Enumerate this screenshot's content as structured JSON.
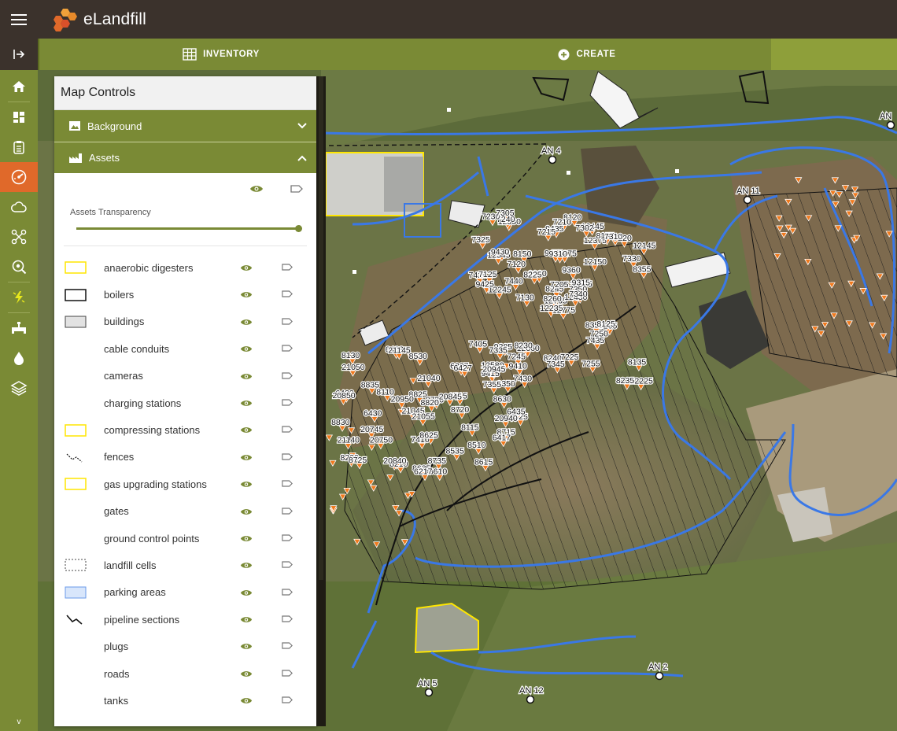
{
  "app": {
    "name": "eLandfill"
  },
  "tabs": [
    {
      "label": "INVENTORY",
      "icon": "table-icon"
    },
    {
      "label": "CREATE",
      "icon": "add-circle-icon"
    }
  ],
  "rail": {
    "items": [
      "home-icon",
      "dashboard-icon",
      "clipboard-icon",
      "gauge-icon",
      "cloud-icon",
      "drone-icon",
      "search-eye-icon",
      "lightning-icon",
      "pipe-icon",
      "drop-icon",
      "layers-icon"
    ],
    "active_index": 3,
    "bottom_label": "v"
  },
  "panel": {
    "title": "Map Controls",
    "sections": [
      {
        "label": "Background",
        "expanded": false
      },
      {
        "label": "Assets",
        "expanded": true
      }
    ],
    "transparency_label": "Assets Transparency",
    "transparency_value": 1.0,
    "layers": [
      {
        "label": "anaerobic digesters",
        "swatch": "yellow-box"
      },
      {
        "label": "boilers",
        "swatch": "black-box"
      },
      {
        "label": "buildings",
        "swatch": "grey-box"
      },
      {
        "label": "cable conduits",
        "swatch": "none"
      },
      {
        "label": "cameras",
        "swatch": "none"
      },
      {
        "label": "charging stations",
        "swatch": "none"
      },
      {
        "label": "compressing stations",
        "swatch": "yellow-box"
      },
      {
        "label": "fences",
        "swatch": "fence-line"
      },
      {
        "label": "gas upgrading stations",
        "swatch": "yellow-box"
      },
      {
        "label": "gates",
        "swatch": "none"
      },
      {
        "label": "ground control points",
        "swatch": "none"
      },
      {
        "label": "landfill cells",
        "swatch": "dashed-box"
      },
      {
        "label": "parking areas",
        "swatch": "blue-box"
      },
      {
        "label": "pipeline sections",
        "swatch": "pipe-line"
      },
      {
        "label": "plugs",
        "swatch": "none"
      },
      {
        "label": "roads",
        "swatch": "none"
      },
      {
        "label": "tanks",
        "swatch": "none"
      }
    ]
  },
  "map": {
    "anchors": [
      "AN 4",
      "AN 11",
      "AN 5",
      "AN 12",
      "AN 2",
      "AN"
    ],
    "well_labels": [
      "12775",
      "12545",
      "12765",
      "12580",
      "12675",
      "12660",
      "12445",
      "12275",
      "12375",
      "12430",
      "12330",
      "12225",
      "12245",
      "12145",
      "12235",
      "12150",
      "9350",
      "9455",
      "9360",
      "9385",
      "9260",
      "9415",
      "9410",
      "9310",
      "9315",
      "9205",
      "9430",
      "9435",
      "9425",
      "8350",
      "8355",
      "8260",
      "8240",
      "8245",
      "8150",
      "8155",
      "8230",
      "8235",
      "8135",
      "8125",
      "8120",
      "8225",
      "7440",
      "7435",
      "7430",
      "7425",
      "7350",
      "7355",
      "7345",
      "7340",
      "7335",
      "7330",
      "7325",
      "7250",
      "7255",
      "7245",
      "7240",
      "7230",
      "7225",
      "7220",
      "7210",
      "7130",
      "7125",
      "7120",
      "7310",
      "7305",
      "7302",
      "7215",
      "7205",
      "7405",
      "7410",
      "8210",
      "8115",
      "8110",
      "8220",
      "8130",
      "8835",
      "8830",
      "8825",
      "8735",
      "8730",
      "8725",
      "8720",
      "8715",
      "8635",
      "8630",
      "8625",
      "8615",
      "8610",
      "8535",
      "8530",
      "8525",
      "8515",
      "8510",
      "8820",
      "6417",
      "6422",
      "6217",
      "6227",
      "6427",
      "6430",
      "6433",
      "6435",
      "20850",
      "20745",
      "20750",
      "20840",
      "20845",
      "20945",
      "20950",
      "20940",
      "21050",
      "21040",
      "21045",
      "21145",
      "21140",
      "21055"
    ]
  },
  "colors": {
    "brand": "#7a8a35",
    "topbar": "#3b322c",
    "active": "#e0692a",
    "pipe": "#3a78e6",
    "well": "#f07a1e",
    "digester": "#ffe600"
  }
}
